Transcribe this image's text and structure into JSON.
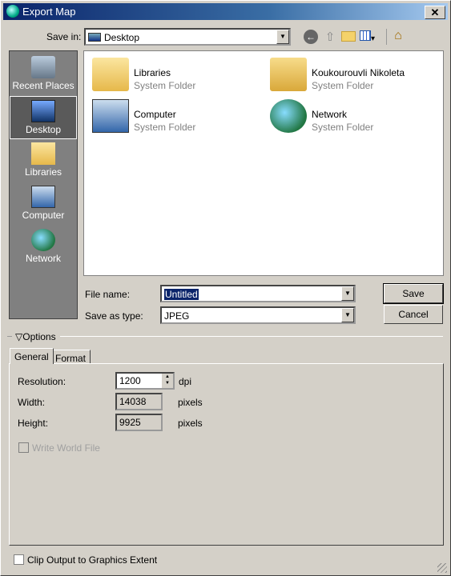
{
  "window": {
    "title": "Export Map",
    "close": "✕"
  },
  "toolbar": {
    "save_in_label": "Save in:",
    "save_in_value": "Desktop",
    "icons": [
      "back-icon",
      "up-folder-icon",
      "new-folder-icon",
      "views-menu-icon",
      "home-icon"
    ]
  },
  "places": [
    {
      "label": "Recent Places"
    },
    {
      "label": "Desktop",
      "selected": true
    },
    {
      "label": "Libraries"
    },
    {
      "label": "Computer"
    },
    {
      "label": "Network"
    }
  ],
  "files": [
    {
      "name": "Libraries",
      "type": "System Folder"
    },
    {
      "name": "Koukourouvli Nikoleta",
      "type": "System Folder"
    },
    {
      "name": "Computer",
      "type": "System Folder"
    },
    {
      "name": "Network",
      "type": "System Folder"
    }
  ],
  "form": {
    "file_name_label": "File name:",
    "file_name_value": "Untitled",
    "type_label": "Save as type:",
    "type_value": "JPEG",
    "save": "Save",
    "cancel": "Cancel"
  },
  "options": {
    "label": "Options",
    "tabs": [
      "General",
      "Format"
    ],
    "active_tab": "General",
    "resolution_label": "Resolution:",
    "resolution": "1200",
    "resolution_unit": "dpi",
    "width_label": "Width:",
    "width": "14038",
    "width_unit": "pixels",
    "height_label": "Height:",
    "height": "9925",
    "height_unit": "pixels",
    "world_file": "Write World File"
  },
  "clip": "Clip Output to Graphics Extent"
}
